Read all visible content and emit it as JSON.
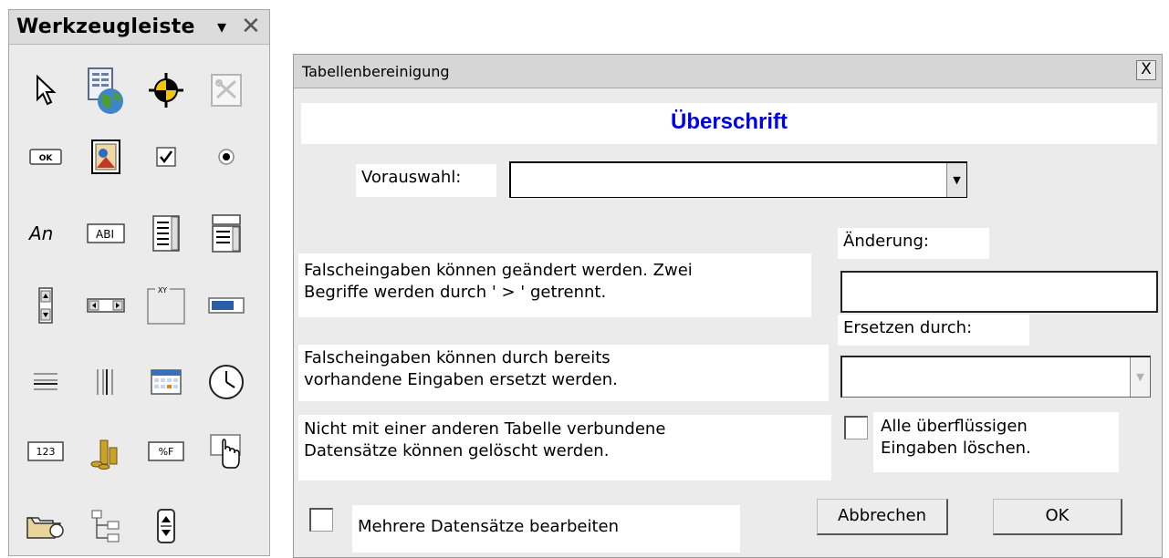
{
  "toolbar": {
    "title": "Werkzeugleiste",
    "menu_glyph": "▾",
    "close_glyph": "✕",
    "icons": [
      "select-pointer-icon",
      "form-navigator-icon",
      "form-design-icon",
      "design-mode-icon",
      "push-button-icon",
      "image-button-icon",
      "checkbox-icon",
      "option-button-icon",
      "label-field-icon",
      "text-box-icon",
      "list-box-icon",
      "combo-box-icon",
      "spin-button-icon",
      "scrollbar-icon",
      "group-box-icon",
      "progress-bar-icon",
      "horizontal-line-icon",
      "vertical-line-icon",
      "date-field-icon",
      "time-field-icon",
      "numeric-field-icon",
      "currency-field-icon",
      "formatted-field-icon",
      "image-control-icon",
      "file-selection-icon",
      "tree-control-icon",
      "navigation-bar-icon"
    ],
    "texts": {
      "label": "An",
      "textbox": "ABI",
      "ok": "OK",
      "numeric": "123",
      "formatted": "%F",
      "xy": "XY"
    }
  },
  "dialog": {
    "title": "Tabellenbereinigung",
    "close_glyph": "X",
    "heading": "Überschrift",
    "vorauswahl_label": "Vorauswahl:",
    "vorauswahl_value": "",
    "aenderung_label": "Änderung:",
    "aenderung_value": "",
    "ersetzen_label": "Ersetzen durch:",
    "ersetzen_value": "",
    "text1_line1": "Falscheingaben können geändert werden. Zwei",
    "text1_line2": "Begriffe werden durch ' > ' getrennt.",
    "text2_line1": "Falscheingaben können durch bereits",
    "text2_line2": "vorhandene Eingaben ersetzt werden.",
    "text3_line1": "Nicht mit einer anderen Tabelle verbundene",
    "text3_line2": "Datensätze können gelöscht werden.",
    "delete_label_line1": "Alle überflüssigen",
    "delete_label_line2": "Eingaben löschen.",
    "multi_label": "Mehrere Datensätze bearbeiten",
    "cancel_label": "Abbrechen",
    "ok_label": "OK",
    "heading_color": "#0000e6"
  }
}
